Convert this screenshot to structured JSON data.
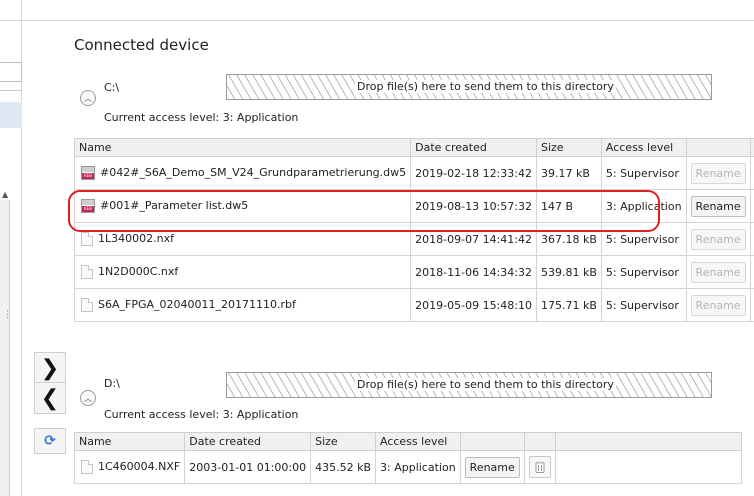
{
  "section_title": "Connected device",
  "drives": [
    {
      "label": "C:\\",
      "access_level": "Current access level: 3: Application",
      "dropzone_text": "Drop file(s) here to send them to this directory",
      "columns": [
        "Name",
        "Date created",
        "Size",
        "Access level"
      ],
      "files": [
        {
          "name": "#042#_S6A_Demo_SM_V24_Grundparametrierung.dw5",
          "icon": "keb-file-icon",
          "date": "2019-02-18 12:33:42",
          "size": "39.17 kB",
          "access": "5: Supervisor",
          "rename": "Rename",
          "rename_enabled": false
        },
        {
          "name": "#001#_Parameter list.dw5",
          "icon": "keb-file-icon",
          "date": "2019-08-13 10:57:32",
          "size": "147 B",
          "access": "3: Application",
          "rename": "Rename",
          "rename_enabled": true
        },
        {
          "name": "1L340002.nxf",
          "icon": "document-icon",
          "date": "2018-09-07 14:41:42",
          "size": "367.18 kB",
          "access": "5: Supervisor",
          "rename": "Rename",
          "rename_enabled": false
        },
        {
          "name": "1N2D000C.nxf",
          "icon": "document-icon",
          "date": "2018-11-06 14:34:32",
          "size": "539.81 kB",
          "access": "5: Supervisor",
          "rename": "Rename",
          "rename_enabled": false
        },
        {
          "name": "S6A_FPGA_02040011_20171110.rbf",
          "icon": "document-icon",
          "date": "2019-05-09 15:48:10",
          "size": "175.71 kB",
          "access": "5: Supervisor",
          "rename": "Rename",
          "rename_enabled": false
        }
      ]
    },
    {
      "label": "D:\\",
      "access_level": "Current access level: 3: Application",
      "dropzone_text": "Drop file(s) here to send them to this directory",
      "columns": [
        "Name",
        "Date created",
        "Size",
        "Access level"
      ],
      "files": [
        {
          "name": "1C460004.NXF",
          "icon": "document-icon",
          "date": "2003-01-01 01:00:00",
          "size": "435.52 kB",
          "access": "3: Application",
          "rename": "Rename",
          "rename_enabled": true
        }
      ]
    }
  ],
  "transfer_buttons": {
    "send": "❯",
    "receive": "❮",
    "refresh": "⟳"
  },
  "colors": {
    "highlight": "#e02020",
    "keb_brand": "#c0265f"
  }
}
